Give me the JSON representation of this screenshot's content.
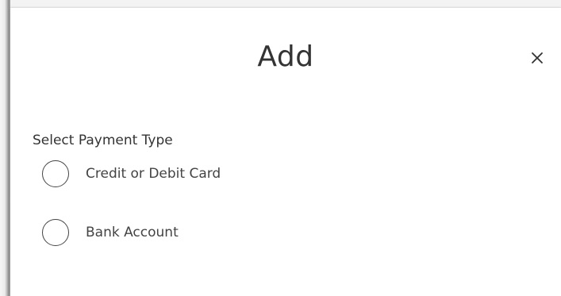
{
  "dialog": {
    "title": "Add",
    "close_icon": "close-icon"
  },
  "payment": {
    "section_label": "Select Payment Type",
    "options": [
      {
        "label": "Credit or Debit Card",
        "selected": false
      },
      {
        "label": "Bank Account",
        "selected": false
      }
    ]
  },
  "colors": {
    "text": "#333333",
    "border": "#444444",
    "background": "#ffffff"
  }
}
